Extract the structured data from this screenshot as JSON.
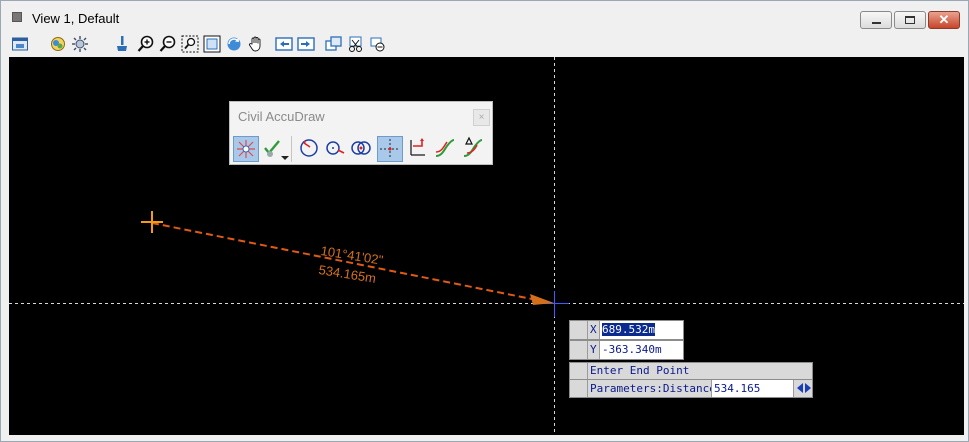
{
  "window": {
    "title": "View 1, Default",
    "close_glyph": "✕"
  },
  "toolbar": {
    "icons": [
      "view-attributes-icon",
      "display-style-icon",
      "lighting-icon",
      "update-view-icon",
      "zoom-in-icon",
      "zoom-out-icon",
      "window-area-icon",
      "fit-view-icon",
      "rotate-view-icon",
      "pan-view-icon",
      "previous-view-icon",
      "next-view-icon",
      "copy-view-icon",
      "clip-volume-icon",
      "camera-icon"
    ]
  },
  "accudraw": {
    "title": "Civil AccuDraw",
    "close_glyph": "×"
  },
  "drawing": {
    "angle_label": "101°41'02\"",
    "distance_label": "534.165m",
    "colors": {
      "line": "#e05a16",
      "text": "#d4701c",
      "crosshair": "#ffffff",
      "background": "#000000"
    }
  },
  "coords": {
    "x_label": "X",
    "x_value": "689.532m",
    "y_label": "Y",
    "y_value": "-363.340m"
  },
  "prompt": {
    "message": "Enter End Point",
    "param_label": "Parameters:Distance",
    "param_value": "534.165"
  }
}
